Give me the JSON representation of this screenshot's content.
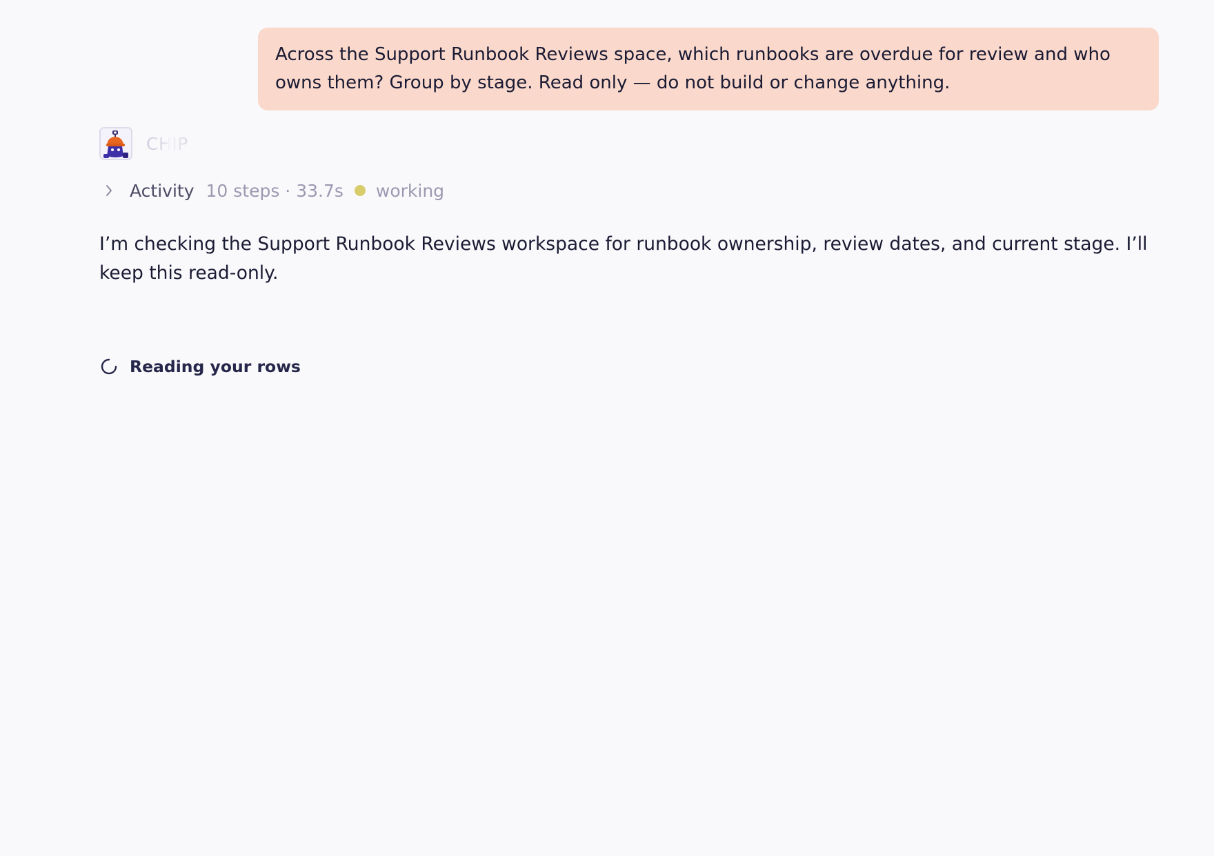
{
  "conversation": {
    "user_message": "Across the Support Runbook Reviews space, which runbooks are overdue for review and who owns them? Group by stage. Read only — do not build or change anything.",
    "assistant": {
      "name": "CHIP",
      "avatar_icon": "robot-mascot-icon",
      "activity": {
        "label": "Activity",
        "meta": "10 steps · 33.7s",
        "status": "working",
        "status_color": "#d8cd6a",
        "expand_icon": "chevron-right-icon"
      },
      "message": "I’m checking the Support Runbook Reviews workspace for runbook ownership, review dates, and current stage. I’ll keep this read-only.",
      "progress": {
        "icon": "spinner-icon",
        "text": "Reading your rows"
      }
    }
  },
  "colors": {
    "background": "#f9f9fc",
    "user_bubble": "#fad9cc",
    "text_primary": "#1a1a33",
    "text_muted": "#9a99b0"
  }
}
